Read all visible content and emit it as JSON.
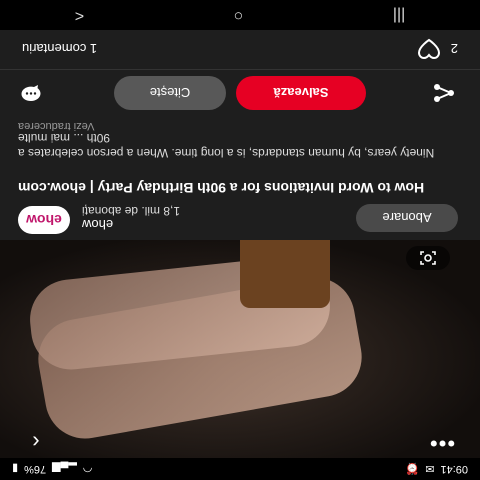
{
  "status": {
    "time": "09:41",
    "battery": "76%"
  },
  "pin": {
    "brand": {
      "logo_text": "ehow",
      "name": "ehow",
      "followers": "1,8 mil. de abonați"
    },
    "follow_label": "Abonare",
    "title": "How to Word Invitations for a 90th Birthday Party | ehow.com",
    "description": "Ninety years, by human standards, is a long time. When a person celebrates a 90th ... mai multe",
    "translate_label": "Vezi traducerea",
    "read_label": "Citește",
    "save_label": "Salvează",
    "comments_label": "1 comentariu",
    "likes_count": "2"
  },
  "nav": {
    "back": "<",
    "home": "○",
    "recents": "|||"
  },
  "colors": {
    "save": "#e60023",
    "brand": "#c0166b"
  }
}
